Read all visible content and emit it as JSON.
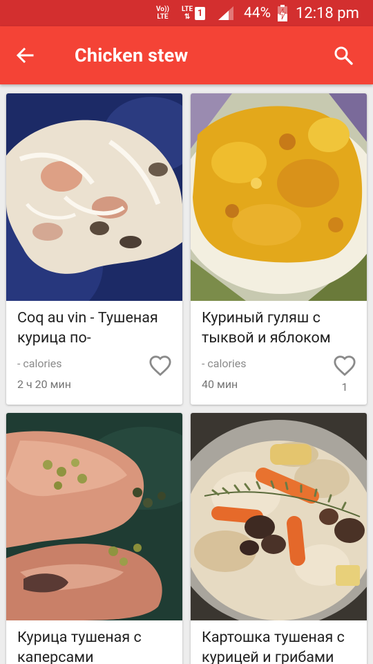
{
  "status_bar": {
    "volte_top": "Vo))",
    "volte_bottom": "LTE",
    "lte_top": "LTE",
    "lte_bottom": "⇅",
    "sim_slot": "1",
    "battery": "44%",
    "time": "12:18 pm"
  },
  "app_bar": {
    "title": "Chicken stew"
  },
  "recipes": [
    {
      "name": "Coq au vin - Тушеная курица по-",
      "calories": "- calories",
      "time": "2 ч 20 мин",
      "likes": ""
    },
    {
      "name": "Куриный гуляш с тыквой и яблоком",
      "calories": "- calories",
      "time": "40 мин",
      "likes": "1"
    },
    {
      "name": "Курица тушеная с каперсами",
      "calories": "",
      "time": "",
      "likes": ""
    },
    {
      "name": "Картошка тушеная с курицей и грибами",
      "calories": "",
      "time": "",
      "likes": ""
    }
  ],
  "colors": {
    "status_bar": "#d32f2f",
    "app_bar": "#f44336",
    "background": "#ededed"
  },
  "icons": {
    "back": "arrow-back-icon",
    "search": "search-icon",
    "favorite": "heart-outline-icon"
  }
}
